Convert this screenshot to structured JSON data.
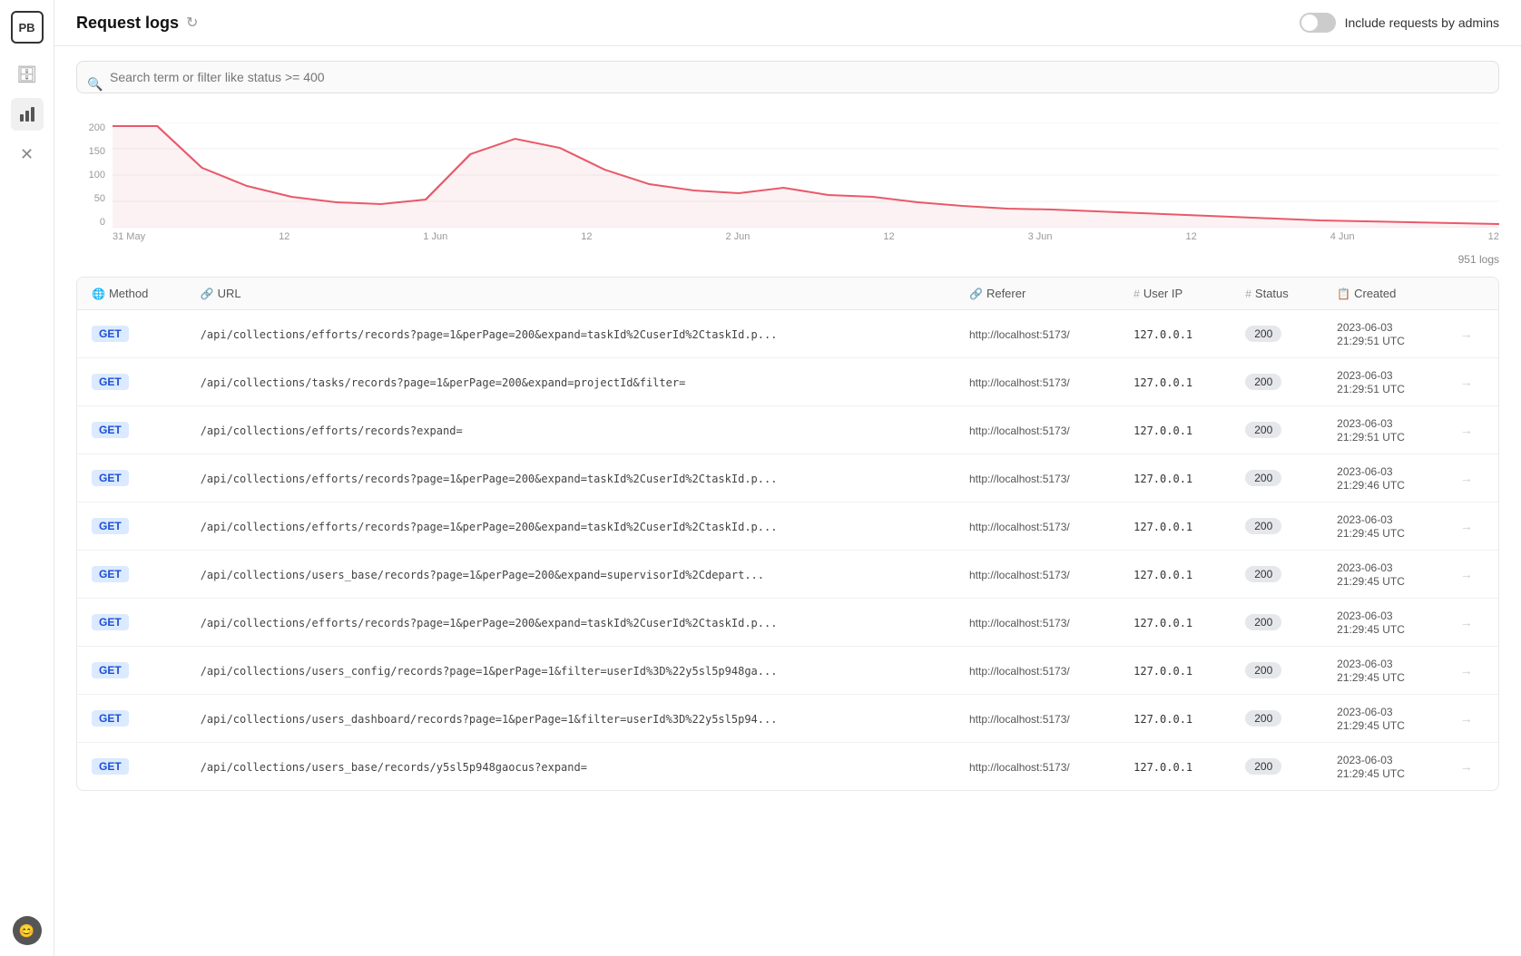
{
  "sidebar": {
    "logo": "PB",
    "items": [
      {
        "name": "database-icon",
        "icon": "🗄",
        "active": false
      },
      {
        "name": "chart-icon",
        "icon": "📊",
        "active": true
      },
      {
        "name": "tools-icon",
        "icon": "✕",
        "active": false
      }
    ],
    "avatar": "😊"
  },
  "header": {
    "title": "Request logs",
    "include_admins_label": "Include requests by admins",
    "toggle_on": false
  },
  "search": {
    "placeholder": "Search term or filter like status >= 400"
  },
  "chart": {
    "y_labels": [
      "200",
      "150",
      "100",
      "50",
      "0"
    ],
    "x_labels": [
      "31 May",
      "12",
      "1 Jun",
      "12",
      "2 Jun",
      "12",
      "3 Jun",
      "12",
      "4 Jun",
      "12"
    ]
  },
  "logs_count": "951 logs",
  "table": {
    "columns": [
      {
        "label": "Method",
        "icon": "🌐"
      },
      {
        "label": "URL",
        "icon": "🔗"
      },
      {
        "label": "Referer",
        "icon": "🔗"
      },
      {
        "label": "User IP",
        "icon": "#"
      },
      {
        "label": "Status",
        "icon": "#"
      },
      {
        "label": "Created",
        "icon": "📋"
      }
    ],
    "rows": [
      {
        "method": "GET",
        "url": "/api/collections/efforts/records?page=1&perPage=200&expand=taskId%2CuserId%2CtaskId.p...",
        "referer": "http://localhost:5173/",
        "ip": "127.0.0.1",
        "status": "200",
        "date": "2023-06-03",
        "time": "21:29:51 UTC"
      },
      {
        "method": "GET",
        "url": "/api/collections/tasks/records?page=1&perPage=200&expand=projectId&filter=",
        "referer": "http://localhost:5173/",
        "ip": "127.0.0.1",
        "status": "200",
        "date": "2023-06-03",
        "time": "21:29:51 UTC"
      },
      {
        "method": "GET",
        "url": "/api/collections/efforts/records?expand=",
        "referer": "http://localhost:5173/",
        "ip": "127.0.0.1",
        "status": "200",
        "date": "2023-06-03",
        "time": "21:29:51 UTC"
      },
      {
        "method": "GET",
        "url": "/api/collections/efforts/records?page=1&perPage=200&expand=taskId%2CuserId%2CtaskId.p...",
        "referer": "http://localhost:5173/",
        "ip": "127.0.0.1",
        "status": "200",
        "date": "2023-06-03",
        "time": "21:29:46 UTC"
      },
      {
        "method": "GET",
        "url": "/api/collections/efforts/records?page=1&perPage=200&expand=taskId%2CuserId%2CtaskId.p...",
        "referer": "http://localhost:5173/",
        "ip": "127.0.0.1",
        "status": "200",
        "date": "2023-06-03",
        "time": "21:29:45 UTC"
      },
      {
        "method": "GET",
        "url": "/api/collections/users_base/records?page=1&perPage=200&expand=supervisorId%2Cdepart...",
        "referer": "http://localhost:5173/",
        "ip": "127.0.0.1",
        "status": "200",
        "date": "2023-06-03",
        "time": "21:29:45 UTC"
      },
      {
        "method": "GET",
        "url": "/api/collections/efforts/records?page=1&perPage=200&expand=taskId%2CuserId%2CtaskId.p...",
        "referer": "http://localhost:5173/",
        "ip": "127.0.0.1",
        "status": "200",
        "date": "2023-06-03",
        "time": "21:29:45 UTC"
      },
      {
        "method": "GET",
        "url": "/api/collections/users_config/records?page=1&perPage=1&filter=userId%3D%22y5sl5p948ga...",
        "referer": "http://localhost:5173/",
        "ip": "127.0.0.1",
        "status": "200",
        "date": "2023-06-03",
        "time": "21:29:45 UTC"
      },
      {
        "method": "GET",
        "url": "/api/collections/users_dashboard/records?page=1&perPage=1&filter=userId%3D%22y5sl5p94...",
        "referer": "http://localhost:5173/",
        "ip": "127.0.0.1",
        "status": "200",
        "date": "2023-06-03",
        "time": "21:29:45 UTC"
      },
      {
        "method": "GET",
        "url": "/api/collections/users_base/records/y5sl5p948gaocus?expand=",
        "referer": "http://localhost:5173/",
        "ip": "127.0.0.1",
        "status": "200",
        "date": "2023-06-03",
        "time": "21:29:45 UTC"
      }
    ]
  }
}
